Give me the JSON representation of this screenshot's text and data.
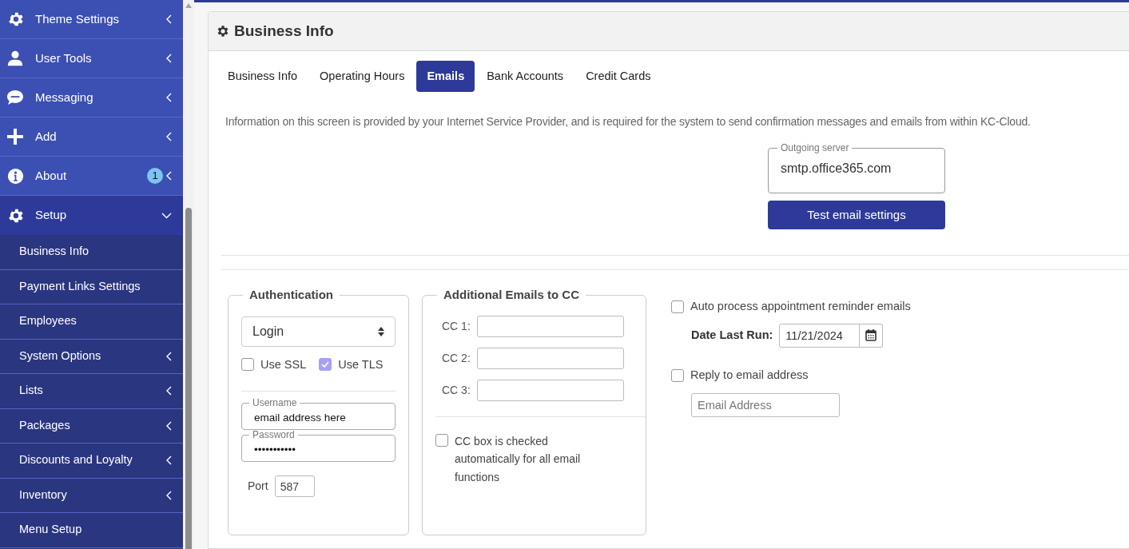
{
  "sidebar": {
    "items": [
      {
        "label": "Theme Settings",
        "expanded": false
      },
      {
        "label": "User Tools",
        "expanded": false
      },
      {
        "label": "Messaging",
        "expanded": false
      },
      {
        "label": "Add",
        "expanded": false
      },
      {
        "label": "About",
        "expanded": false,
        "badge": "1"
      },
      {
        "label": "Setup",
        "expanded": true,
        "children": [
          {
            "label": "Business Info",
            "kind": "link"
          },
          {
            "label": "Payment Links Settings",
            "kind": "link"
          },
          {
            "label": "Employees",
            "kind": "link"
          },
          {
            "label": "System Options",
            "kind": "group"
          },
          {
            "label": "Lists",
            "kind": "group"
          },
          {
            "label": "Packages",
            "kind": "group"
          },
          {
            "label": "Discounts and Loyalty",
            "kind": "group"
          },
          {
            "label": "Inventory",
            "kind": "group"
          },
          {
            "label": "Menu Setup",
            "kind": "link"
          }
        ]
      }
    ]
  },
  "page": {
    "title": "Business Info",
    "tabs": [
      {
        "label": "Business Info",
        "selected": false
      },
      {
        "label": "Operating Hours",
        "selected": false
      },
      {
        "label": "Emails",
        "selected": true
      },
      {
        "label": "Bank Accounts",
        "selected": false
      },
      {
        "label": "Credit Cards",
        "selected": false
      }
    ],
    "info_text": "Information on this screen is provided by your Internet Service Provider, and is required for the system to send confirmation messages and emails from within KC-Cloud.",
    "outgoing_server": {
      "label": "Outgoing server",
      "value": "smtp.office365.com"
    },
    "test_button": "Test email settings",
    "authentication": {
      "legend": "Authentication",
      "method": "Login",
      "options": [
        {
          "label": "Use SSL",
          "checked": false
        },
        {
          "label": "Use TLS",
          "checked": true
        }
      ],
      "username": {
        "label": "Username",
        "value": "email address here"
      },
      "password": {
        "label": "Password",
        "value": "•••••••••••"
      },
      "port": {
        "label": "Port",
        "value": "587"
      }
    },
    "cc": {
      "legend": "Additional Emails to CC",
      "fields": [
        {
          "label": "CC 1:"
        },
        {
          "label": "CC 2:"
        },
        {
          "label": "CC 3:"
        }
      ],
      "auto_check": {
        "label": "CC box is checked automatically for all email functions",
        "checked": false
      }
    },
    "reminders": {
      "label": "Auto process appointment reminder emails",
      "checked": false,
      "date_label": "Date Last Run:",
      "date_value": "11/21/2024"
    },
    "reply_to": {
      "label": "Reply to email address",
      "checked": false,
      "placeholder": "Email Address"
    }
  }
}
